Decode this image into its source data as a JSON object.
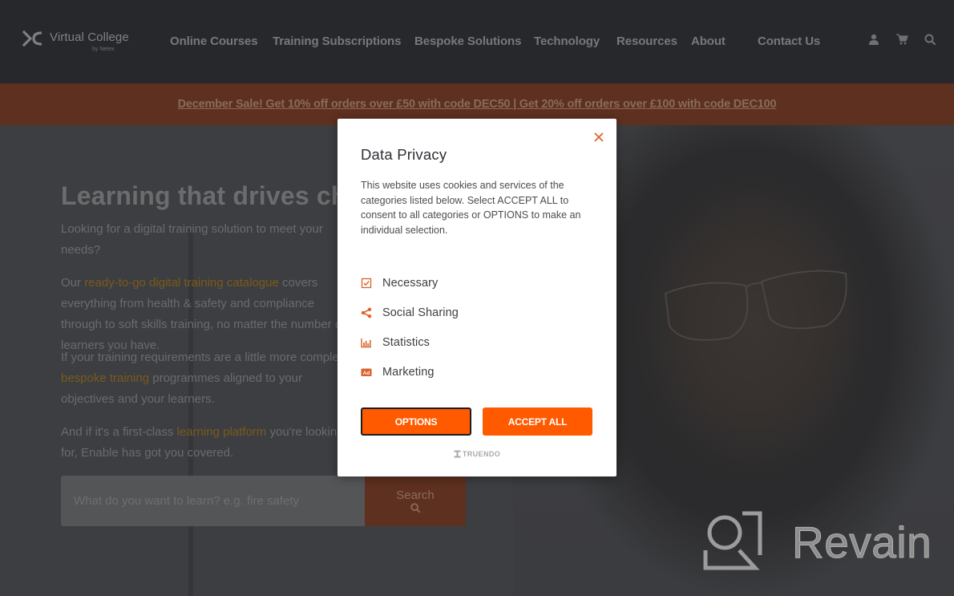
{
  "header": {
    "logo": {
      "name": "Virtual College",
      "sub": "by Netex"
    },
    "nav": [
      {
        "label": "Online Courses"
      },
      {
        "label": "Training Subscriptions"
      },
      {
        "label": "Bespoke Solutions"
      },
      {
        "label": "Technology"
      },
      {
        "label": "Resources"
      },
      {
        "label": "About"
      },
      {
        "label": "Contact Us"
      }
    ],
    "icons": [
      "user-icon",
      "cart-icon",
      "search-icon"
    ]
  },
  "promo": {
    "text": "December Sale! Get 10% off orders over £50 with code DEC50 | Get 20% off orders over £100 with code DEC100"
  },
  "hero": {
    "title": "Learning that drives change",
    "paragraphs": [
      {
        "before": "Looking for a digital training solution to meet your needs?",
        "link": "",
        "after": ""
      },
      {
        "before": "Our ",
        "link": "ready-to-go digital training catalogue",
        "after": " covers everything from health & safety and compliance through to soft skills training, no matter the number of learners you have."
      },
      {
        "before": "If your training requirements are a little more complex, ",
        "link": "bespoke training",
        "after": " programmes aligned to your objectives and your learners."
      },
      {
        "before": "And if it's a first-class ",
        "link": "learning platform",
        "after": " you're looking for, Enable has got you covered."
      }
    ],
    "search": {
      "placeholder": "What do you want to learn? e.g. fire safety",
      "value": "",
      "button_label": "Search"
    }
  },
  "modal": {
    "title": "Data Privacy",
    "description": "This website uses cookies and services of the categories listed below. Select ACCEPT ALL to consent to all categories or OPTIONS to make an individual selection.",
    "categories": [
      {
        "label": "Necessary",
        "icon": "checkbox-icon"
      },
      {
        "label": "Social Sharing",
        "icon": "share-icon"
      },
      {
        "label": "Statistics",
        "icon": "bar-chart-icon"
      },
      {
        "label": "Marketing",
        "icon": "ad-icon"
      }
    ],
    "options_label": "OPTIONS",
    "accept_label": "ACCEPT ALL",
    "powered_by": "TRUENDO",
    "accent_color": "#ff5a00"
  },
  "watermark": {
    "text": "Revain"
  }
}
